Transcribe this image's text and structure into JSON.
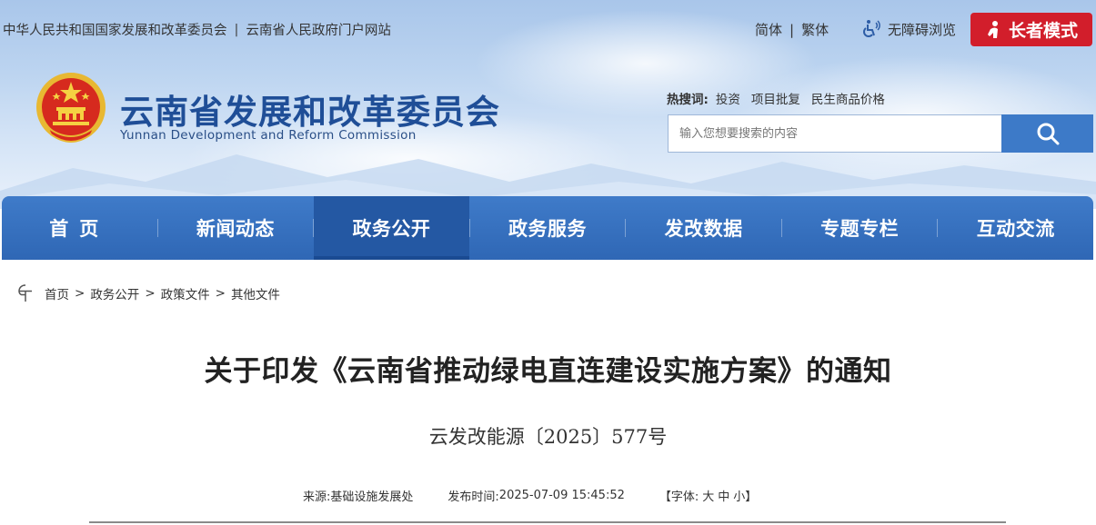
{
  "topbar": {
    "links": [
      "中华人民共和国国家发展和改革委员会",
      "云南省人民政府门户网站"
    ],
    "separator": "|",
    "lang_simplified": "简体",
    "lang_traditional": "繁体",
    "lang_separator": "|",
    "accessibility": "无障碍浏览",
    "elder_mode": "长者模式"
  },
  "site": {
    "title": "云南省发展和改革委员会",
    "subtitle": "Yunnan Development and Reform Commission"
  },
  "hot_search": {
    "label": "热搜词:",
    "keywords": [
      "投资",
      "项目批复",
      "民生商品价格"
    ]
  },
  "search": {
    "placeholder": "输入您想要搜索的内容"
  },
  "nav": {
    "items": [
      "首页",
      "新闻动态",
      "政务公开",
      "政务服务",
      "发改数据",
      "专题专栏",
      "互动交流"
    ],
    "active_index": 2
  },
  "breadcrumb": {
    "items": [
      "首页",
      "政务公开",
      "政策文件",
      "其他文件"
    ],
    "separator": ">"
  },
  "article": {
    "title": "关于印发《云南省推动绿电直连建设实施方案》的通知",
    "doc_number": "云发改能源〔2025〕577号",
    "source_label": "来源:",
    "source": "基础设施发展处",
    "date_label": "发布时间:",
    "date": "2025-07-09 15:45:52",
    "font_label": "【字体:",
    "font_large": "大",
    "font_medium": "中",
    "font_small": "小】"
  },
  "colors": {
    "nav_bg": "#3572bf",
    "nav_active": "#2458a3",
    "elder_button": "#d21e2b",
    "title_blue": "#1f4e97",
    "search_button": "#3d7ac8"
  }
}
